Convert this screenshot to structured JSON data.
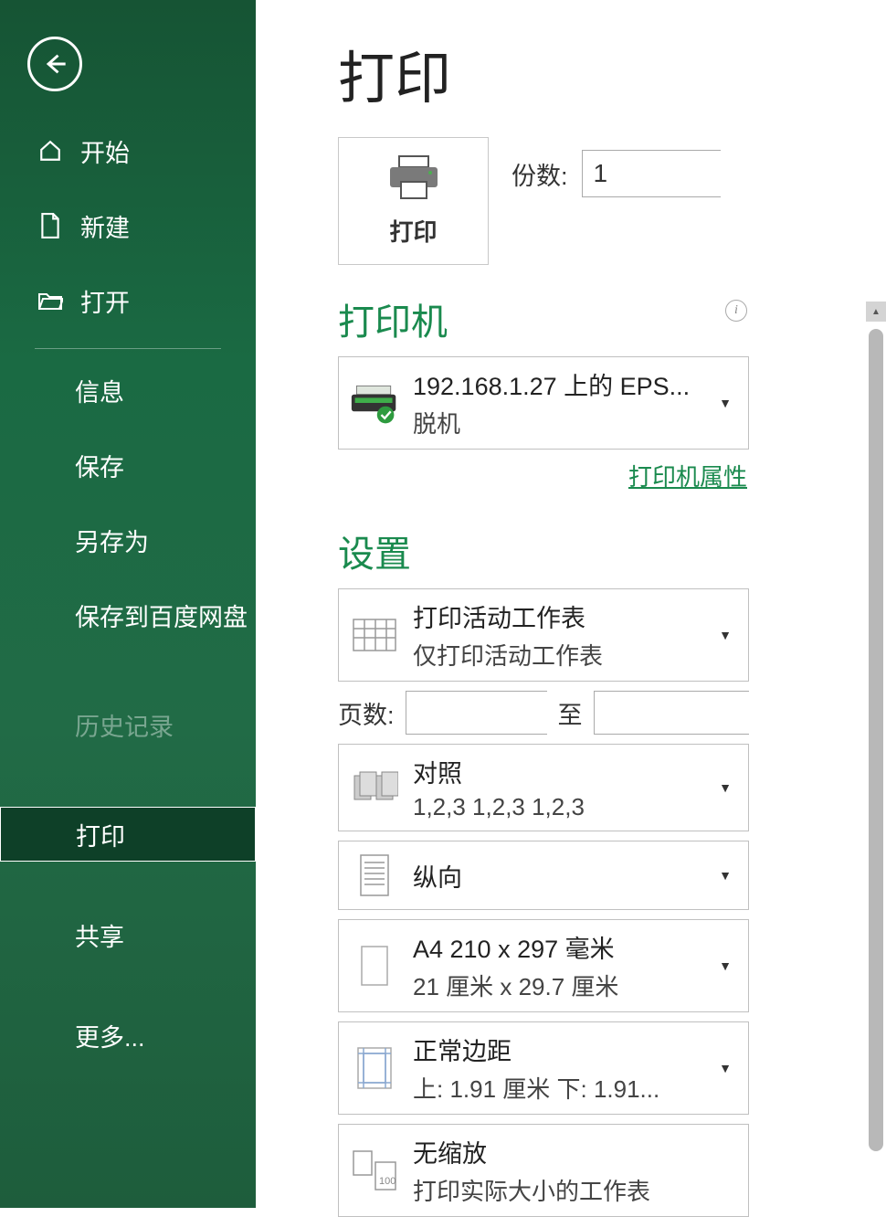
{
  "sidebar": {
    "items": [
      {
        "label": "开始",
        "icon": "home"
      },
      {
        "label": "新建",
        "icon": "file"
      },
      {
        "label": "打开",
        "icon": "folder"
      },
      {
        "label": "信息"
      },
      {
        "label": "保存"
      },
      {
        "label": "另存为"
      },
      {
        "label": "保存到百度网盘"
      },
      {
        "label": "历史记录",
        "disabled": true
      },
      {
        "label": "打印",
        "selected": true
      },
      {
        "label": "共享"
      },
      {
        "label": "更多..."
      }
    ]
  },
  "main": {
    "title": "打印",
    "print_button": "打印",
    "copies_label": "份数:",
    "copies_value": "1",
    "printer": {
      "heading": "打印机",
      "name": "192.168.1.27 上的 EPS...",
      "status": "脱机",
      "properties_link": "打印机属性"
    },
    "settings": {
      "heading": "设置",
      "what": {
        "line1": "打印活动工作表",
        "line2": "仅打印活动工作表"
      },
      "pages_label": "页数:",
      "pages_to": "至",
      "collate": {
        "line1": "对照",
        "line2": "1,2,3    1,2,3    1,2,3"
      },
      "orientation": {
        "line1": "纵向"
      },
      "paper": {
        "line1": "A4 210 x 297 毫米",
        "line2": "21 厘米 x 29.7 厘米"
      },
      "margins": {
        "line1": "正常边距",
        "line2": "上: 1.91 厘米 下: 1.91..."
      },
      "scaling": {
        "line1": "无缩放",
        "line2": "打印实际大小的工作表"
      }
    }
  }
}
